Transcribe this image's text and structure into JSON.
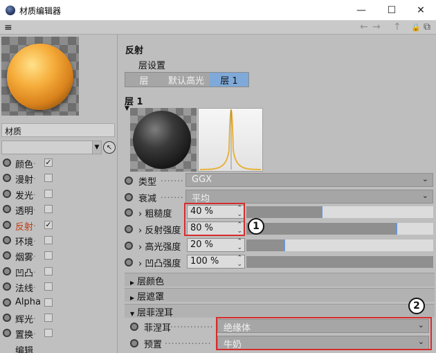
{
  "window": {
    "title": "材质编辑器",
    "controls": [
      "—",
      "☐",
      "✕"
    ]
  },
  "toolbar": {
    "menu_icon": "≡",
    "back": "←",
    "forward": "→",
    "up": "↑",
    "lock": "🔒",
    "new_window": "⧉"
  },
  "left": {
    "material_name": "材质",
    "pick_icon": "↖",
    "channels": [
      {
        "label": "颜色",
        "checked": "✓"
      },
      {
        "label": "漫射",
        "checked": ""
      },
      {
        "label": "发光",
        "checked": ""
      },
      {
        "label": "透明",
        "checked": ""
      },
      {
        "label": "反射",
        "checked": "✓"
      },
      {
        "label": "环境",
        "checked": ""
      },
      {
        "label": "烟雾",
        "checked": ""
      },
      {
        "label": "凹凸",
        "checked": ""
      },
      {
        "label": "法线",
        "checked": ""
      },
      {
        "label": "Alpha",
        "checked": ""
      },
      {
        "label": "辉光",
        "checked": ""
      },
      {
        "label": "置换",
        "checked": ""
      },
      {
        "label": "编辑",
        "checked": ""
      }
    ]
  },
  "right": {
    "section_title": "反射",
    "layer_settings": "层设置",
    "tabs": [
      "层",
      "默认高光",
      "层 1"
    ],
    "layer_title": "层 1",
    "type": {
      "label": "类型",
      "value": "GGX"
    },
    "attenuation": {
      "label": "衰减",
      "value": "平均"
    },
    "roughness": {
      "label": "› 粗糙度",
      "value": "40 %",
      "level": 0.4
    },
    "reflect_strength": {
      "label": "› 反射强度",
      "value": "80 %",
      "level": 0.8
    },
    "spec_strength": {
      "label": "› 高光强度",
      "value": "20 %",
      "level": 0.2
    },
    "bump_strength": {
      "label": "› 凹凸强度",
      "value": "100 %",
      "level": 1.0
    },
    "groups": [
      "层颜色",
      "层遮罩",
      "层菲涅耳"
    ],
    "fresnel": {
      "label": "菲涅耳",
      "value": "绝缘体"
    },
    "preset": {
      "label": "预置",
      "value": "牛奶"
    }
  },
  "annotations": [
    "1",
    "2"
  ],
  "colors": {
    "accent": "#7fa9d8",
    "active_channel": "#c43a10",
    "highlight_box": "#d62b2b"
  }
}
